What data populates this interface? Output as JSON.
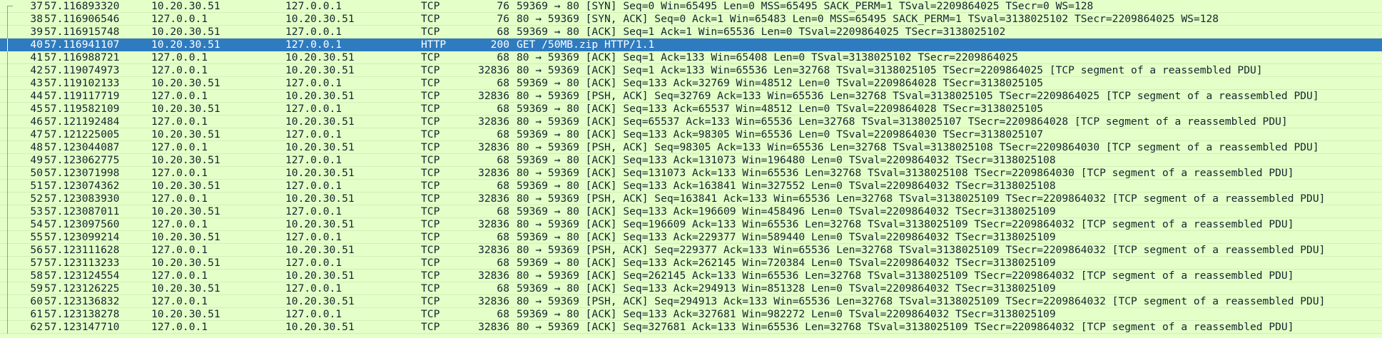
{
  "packets": [
    {
      "no": "37",
      "time": "57.116893320",
      "src": "10.20.30.51",
      "dst": "127.0.0.1",
      "proto": "TCP",
      "len": "76",
      "info": "59369 → 80 [SYN] Seq=0 Win=65495 Len=0 MSS=65495 SACK_PERM=1 TSval=2209864025 TSecr=0 WS=128",
      "selected": false
    },
    {
      "no": "38",
      "time": "57.116906546",
      "src": "127.0.0.1",
      "dst": "10.20.30.51",
      "proto": "TCP",
      "len": "76",
      "info": "80 → 59369 [SYN, ACK] Seq=0 Ack=1 Win=65483 Len=0 MSS=65495 SACK_PERM=1 TSval=3138025102 TSecr=2209864025 WS=128",
      "selected": false
    },
    {
      "no": "39",
      "time": "57.116915748",
      "src": "10.20.30.51",
      "dst": "127.0.0.1",
      "proto": "TCP",
      "len": "68",
      "info": "59369 → 80 [ACK] Seq=1 Ack=1 Win=65536 Len=0 TSval=2209864025 TSecr=3138025102",
      "selected": false
    },
    {
      "no": "40",
      "time": "57.116941107",
      "src": "10.20.30.51",
      "dst": "127.0.0.1",
      "proto": "HTTP",
      "len": "200",
      "info": "GET /50MB.zip HTTP/1.1",
      "selected": true
    },
    {
      "no": "41",
      "time": "57.116988721",
      "src": "127.0.0.1",
      "dst": "10.20.30.51",
      "proto": "TCP",
      "len": "68",
      "info": "80 → 59369 [ACK] Seq=1 Ack=133 Win=65408 Len=0 TSval=3138025102 TSecr=2209864025",
      "selected": false
    },
    {
      "no": "42",
      "time": "57.119074973",
      "src": "127.0.0.1",
      "dst": "10.20.30.51",
      "proto": "TCP",
      "len": "32836",
      "info": "80 → 59369 [ACK] Seq=1 Ack=133 Win=65536 Len=32768 TSval=3138025105 TSecr=2209864025 [TCP segment of a reassembled PDU]",
      "selected": false
    },
    {
      "no": "43",
      "time": "57.119102133",
      "src": "10.20.30.51",
      "dst": "127.0.0.1",
      "proto": "TCP",
      "len": "68",
      "info": "59369 → 80 [ACK] Seq=133 Ack=32769 Win=48512 Len=0 TSval=2209864028 TSecr=3138025105",
      "selected": false
    },
    {
      "no": "44",
      "time": "57.119117719",
      "src": "127.0.0.1",
      "dst": "10.20.30.51",
      "proto": "TCP",
      "len": "32836",
      "info": "80 → 59369 [PSH, ACK] Seq=32769 Ack=133 Win=65536 Len=32768 TSval=3138025105 TSecr=2209864025 [TCP segment of a reassembled PDU]",
      "selected": false
    },
    {
      "no": "45",
      "time": "57.119582109",
      "src": "10.20.30.51",
      "dst": "127.0.0.1",
      "proto": "TCP",
      "len": "68",
      "info": "59369 → 80 [ACK] Seq=133 Ack=65537 Win=48512 Len=0 TSval=2209864028 TSecr=3138025105",
      "selected": false
    },
    {
      "no": "46",
      "time": "57.121192484",
      "src": "127.0.0.1",
      "dst": "10.20.30.51",
      "proto": "TCP",
      "len": "32836",
      "info": "80 → 59369 [ACK] Seq=65537 Ack=133 Win=65536 Len=32768 TSval=3138025107 TSecr=2209864028 [TCP segment of a reassembled PDU]",
      "selected": false
    },
    {
      "no": "47",
      "time": "57.121225005",
      "src": "10.20.30.51",
      "dst": "127.0.0.1",
      "proto": "TCP",
      "len": "68",
      "info": "59369 → 80 [ACK] Seq=133 Ack=98305 Win=65536 Len=0 TSval=2209864030 TSecr=3138025107",
      "selected": false
    },
    {
      "no": "48",
      "time": "57.123044087",
      "src": "127.0.0.1",
      "dst": "10.20.30.51",
      "proto": "TCP",
      "len": "32836",
      "info": "80 → 59369 [PSH, ACK] Seq=98305 Ack=133 Win=65536 Len=32768 TSval=3138025108 TSecr=2209864030 [TCP segment of a reassembled PDU]",
      "selected": false
    },
    {
      "no": "49",
      "time": "57.123062775",
      "src": "10.20.30.51",
      "dst": "127.0.0.1",
      "proto": "TCP",
      "len": "68",
      "info": "59369 → 80 [ACK] Seq=133 Ack=131073 Win=196480 Len=0 TSval=2209864032 TSecr=3138025108",
      "selected": false
    },
    {
      "no": "50",
      "time": "57.123071998",
      "src": "127.0.0.1",
      "dst": "10.20.30.51",
      "proto": "TCP",
      "len": "32836",
      "info": "80 → 59369 [ACK] Seq=131073 Ack=133 Win=65536 Len=32768 TSval=3138025108 TSecr=2209864030 [TCP segment of a reassembled PDU]",
      "selected": false
    },
    {
      "no": "51",
      "time": "57.123074362",
      "src": "10.20.30.51",
      "dst": "127.0.0.1",
      "proto": "TCP",
      "len": "68",
      "info": "59369 → 80 [ACK] Seq=133 Ack=163841 Win=327552 Len=0 TSval=2209864032 TSecr=3138025108",
      "selected": false
    },
    {
      "no": "52",
      "time": "57.123083930",
      "src": "127.0.0.1",
      "dst": "10.20.30.51",
      "proto": "TCP",
      "len": "32836",
      "info": "80 → 59369 [PSH, ACK] Seq=163841 Ack=133 Win=65536 Len=32768 TSval=3138025109 TSecr=2209864032 [TCP segment of a reassembled PDU]",
      "selected": false
    },
    {
      "no": "53",
      "time": "57.123087011",
      "src": "10.20.30.51",
      "dst": "127.0.0.1",
      "proto": "TCP",
      "len": "68",
      "info": "59369 → 80 [ACK] Seq=133 Ack=196609 Win=458496 Len=0 TSval=2209864032 TSecr=3138025109",
      "selected": false
    },
    {
      "no": "54",
      "time": "57.123097560",
      "src": "127.0.0.1",
      "dst": "10.20.30.51",
      "proto": "TCP",
      "len": "32836",
      "info": "80 → 59369 [ACK] Seq=196609 Ack=133 Win=65536 Len=32768 TSval=3138025109 TSecr=2209864032 [TCP segment of a reassembled PDU]",
      "selected": false
    },
    {
      "no": "55",
      "time": "57.123099214",
      "src": "10.20.30.51",
      "dst": "127.0.0.1",
      "proto": "TCP",
      "len": "68",
      "info": "59369 → 80 [ACK] Seq=133 Ack=229377 Win=589440 Len=0 TSval=2209864032 TSecr=3138025109",
      "selected": false
    },
    {
      "no": "56",
      "time": "57.123111628",
      "src": "127.0.0.1",
      "dst": "10.20.30.51",
      "proto": "TCP",
      "len": "32836",
      "info": "80 → 59369 [PSH, ACK] Seq=229377 Ack=133 Win=65536 Len=32768 TSval=3138025109 TSecr=2209864032 [TCP segment of a reassembled PDU]",
      "selected": false
    },
    {
      "no": "57",
      "time": "57.123113233",
      "src": "10.20.30.51",
      "dst": "127.0.0.1",
      "proto": "TCP",
      "len": "68",
      "info": "59369 → 80 [ACK] Seq=133 Ack=262145 Win=720384 Len=0 TSval=2209864032 TSecr=3138025109",
      "selected": false
    },
    {
      "no": "58",
      "time": "57.123124554",
      "src": "127.0.0.1",
      "dst": "10.20.30.51",
      "proto": "TCP",
      "len": "32836",
      "info": "80 → 59369 [ACK] Seq=262145 Ack=133 Win=65536 Len=32768 TSval=3138025109 TSecr=2209864032 [TCP segment of a reassembled PDU]",
      "selected": false
    },
    {
      "no": "59",
      "time": "57.123126225",
      "src": "10.20.30.51",
      "dst": "127.0.0.1",
      "proto": "TCP",
      "len": "68",
      "info": "59369 → 80 [ACK] Seq=133 Ack=294913 Win=851328 Len=0 TSval=2209864032 TSecr=3138025109",
      "selected": false
    },
    {
      "no": "60",
      "time": "57.123136832",
      "src": "127.0.0.1",
      "dst": "10.20.30.51",
      "proto": "TCP",
      "len": "32836",
      "info": "80 → 59369 [PSH, ACK] Seq=294913 Ack=133 Win=65536 Len=32768 TSval=3138025109 TSecr=2209864032 [TCP segment of a reassembled PDU]",
      "selected": false
    },
    {
      "no": "61",
      "time": "57.123138278",
      "src": "10.20.30.51",
      "dst": "127.0.0.1",
      "proto": "TCP",
      "len": "68",
      "info": "59369 → 80 [ACK] Seq=133 Ack=327681 Win=982272 Len=0 TSval=2209864032 TSecr=3138025109",
      "selected": false
    },
    {
      "no": "62",
      "time": "57.123147710",
      "src": "127.0.0.1",
      "dst": "10.20.30.51",
      "proto": "TCP",
      "len": "32836",
      "info": "80 → 59369 [ACK] Seq=327681 Ack=133 Win=65536 Len=32768 TSval=3138025109 TSecr=2209864032 [TCP segment of a reassembled PDU]",
      "selected": false
    }
  ],
  "colors": {
    "tcp_row_bg": "#e4ffc7",
    "selected_row_bg": "#2f7bbf",
    "selected_row_fg": "#ffffff",
    "text": "#12272e"
  }
}
